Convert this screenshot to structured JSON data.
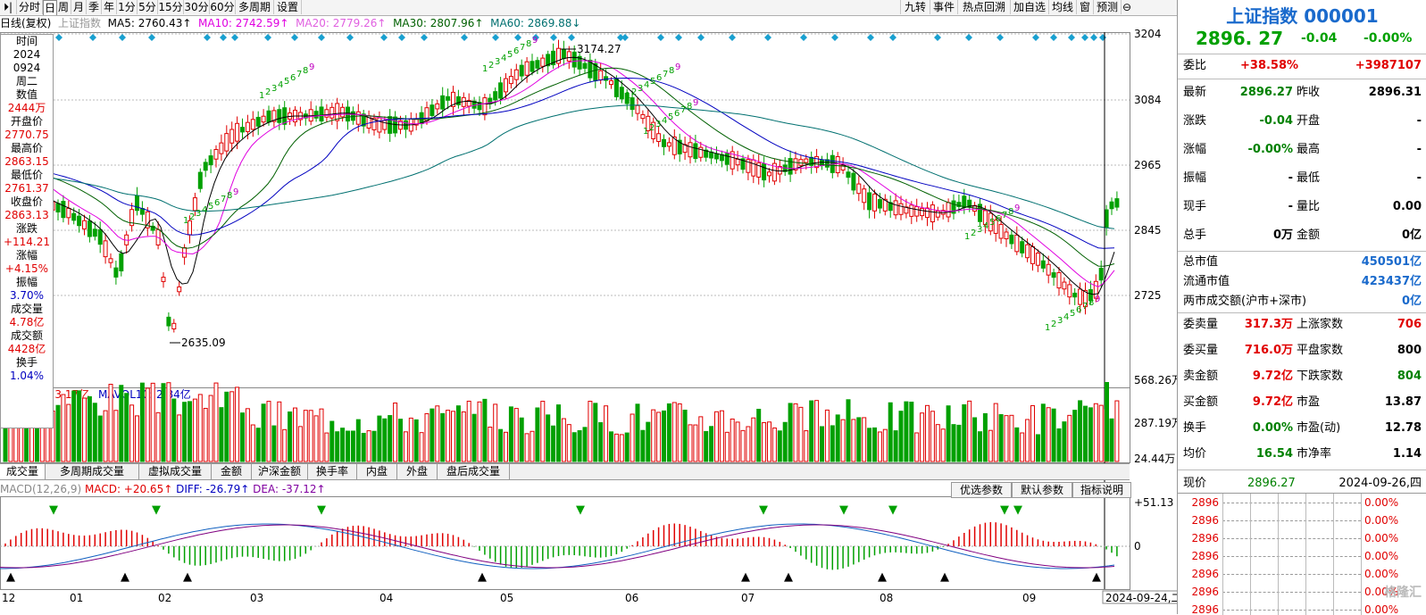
{
  "toolbar": {
    "left": [
      "⏵|",
      "分时",
      "日",
      "周",
      "月",
      "季",
      "年",
      "1分",
      "5分",
      "15分",
      "30分",
      "60分",
      "多周期",
      "设置"
    ],
    "active": "日",
    "right": [
      "九转",
      "事件",
      "热点回溯",
      "加自选",
      "均线",
      "窗",
      "预测"
    ]
  },
  "indicator_line": {
    "name": "日线(复权)",
    "symbol": "上证指数",
    "ma5": "MA5: 2760.43↑",
    "ma10": "MA10: 2742.59↑",
    "ma20": "MA20: 2779.26↑",
    "ma30": "MA30: 2807.96↑",
    "ma60": "MA60: 2869.88↓"
  },
  "y_axis_labels": [
    "3204",
    "3084",
    "2965",
    "2845",
    "2725"
  ],
  "annotations": {
    "high": "3174.27",
    "low": "2635.09"
  },
  "vol_line": {
    "mavol5": "MAVOL5: 3.17亿",
    "mavol10": "MAVOL10: 2.84亿"
  },
  "vol_axis_labels": [
    "568.26万",
    "287.19万",
    "24.44万"
  ],
  "tooltip": {
    "items": [
      "时间",
      "2024",
      "0924",
      "周二",
      "数值",
      "2444万",
      "开盘价",
      "2770.75",
      "最高价",
      "2863.15",
      "最低价",
      "2761.37",
      "收盘价",
      "2863.13",
      "涨跌",
      "+114.21",
      "涨幅",
      "+4.15%",
      "振幅",
      "3.70%",
      "成交量",
      "4.78亿",
      "成交额",
      "4428亿",
      "换手",
      "1.04%"
    ]
  },
  "subtabs": [
    "成交量",
    "多周期成交量",
    "虚拟成交量",
    "金额",
    "沪深金额",
    "换手率",
    "内盘",
    "外盘",
    "盘后成交量"
  ],
  "macd_line": {
    "name": "MACD(12,26,9)",
    "macd": "MACD: +20.65↑",
    "diff": "DIFF: -26.79↑",
    "dea": "DEA: -37.12↑"
  },
  "macd_buttons": [
    "优选参数",
    "默认参数",
    "指标说明"
  ],
  "macd_axis_labels": [
    "+51.13",
    "0"
  ],
  "x_axis_labels": [
    "12",
    "01",
    "02",
    "03",
    "04",
    "05",
    "06",
    "07",
    "08",
    "09"
  ],
  "x_axis_date": "2024-09-24,二",
  "td_counts": [
    {
      "t": "1",
      "c": "grn"
    },
    {
      "t": "2",
      "c": "grn"
    },
    {
      "t": "3",
      "c": "grn"
    },
    {
      "t": "4",
      "c": "grn"
    },
    {
      "t": "5",
      "c": "grn"
    },
    {
      "t": "6",
      "c": "grn"
    },
    {
      "t": "7",
      "c": "grn"
    },
    {
      "t": "8",
      "c": "grn"
    },
    {
      "t": "9",
      "c": "mag"
    }
  ],
  "right_panel": {
    "title": "上证指数 000001",
    "price": "2896. 27",
    "change": "-0.04",
    "change_pct": "-0.00%",
    "weibi_label": "委比",
    "weibi_pct": "+38.58%",
    "weibi_val": "+3987107",
    "rows": [
      {
        "l1": "最新",
        "v1": "2896.27",
        "c1": "grn",
        "l2": "昨收",
        "v2": "2896.31",
        "c2": ""
      },
      {
        "l1": "涨跌",
        "v1": "-0.04",
        "c1": "grn",
        "l2": "开盘",
        "v2": "-",
        "c2": ""
      },
      {
        "l1": "涨幅",
        "v1": "-0.00%",
        "c1": "grn",
        "l2": "最高",
        "v2": "-",
        "c2": ""
      },
      {
        "l1": "振幅",
        "v1": "-",
        "c1": "",
        "l2": "最低",
        "v2": "-",
        "c2": ""
      },
      {
        "l1": "现手",
        "v1": "-",
        "c1": "",
        "l2": "量比",
        "v2": "0.00",
        "c2": ""
      },
      {
        "l1": "总手",
        "v1": "0万",
        "c1": "",
        "l2": "金额",
        "v2": "0亿",
        "c2": ""
      }
    ],
    "market": [
      {
        "l": "总市值",
        "v": "450501亿"
      },
      {
        "l": "流通市值",
        "v": "423437亿"
      },
      {
        "l": "两市成交额(沪市+深市)",
        "v": "0亿"
      }
    ],
    "rows2": [
      {
        "l1": "委卖量",
        "v1": "317.3万",
        "c1": "red",
        "l2": "上涨家数",
        "v2": "706",
        "c2": "red"
      },
      {
        "l1": "委买量",
        "v1": "716.0万",
        "c1": "red",
        "l2": "平盘家数",
        "v2": "800",
        "c2": ""
      },
      {
        "l1": "卖金额",
        "v1": "9.72亿",
        "c1": "red",
        "l2": "下跌家数",
        "v2": "804",
        "c2": "grn"
      },
      {
        "l1": "买金额",
        "v1": "9.72亿",
        "c1": "red",
        "l2": "市盈",
        "v2": "13.87",
        "c2": ""
      },
      {
        "l1": "换手",
        "v1": "0.00%",
        "c1": "grn",
        "l2": "市盈(动)",
        "v2": "12.78",
        "c2": ""
      },
      {
        "l1": "均价",
        "v1": "16.54",
        "c1": "grn",
        "l2": "市净率",
        "v2": "1.14",
        "c2": ""
      }
    ],
    "tick_header": {
      "label": "现价",
      "price": "2896.27",
      "date": "2024-09-26,四"
    },
    "tick_prices": [
      "2896",
      "2896",
      "2896",
      "2896",
      "2896",
      "2896",
      "2896",
      "2896"
    ],
    "tick_pcts": [
      "0.00%",
      "0.00%",
      "0.00%",
      "0.00%",
      "0.00%",
      "0.00%",
      "0.00%"
    ],
    "watermark": "格隆汇"
  },
  "colors": {
    "up": "#e00000",
    "down": "#00a000",
    "ma5": "#000000",
    "ma10": "#e000e0",
    "ma20": "#006000",
    "ma30": "#0000c0",
    "ma60": "#007070",
    "diamond": "#1aa0d0"
  }
}
